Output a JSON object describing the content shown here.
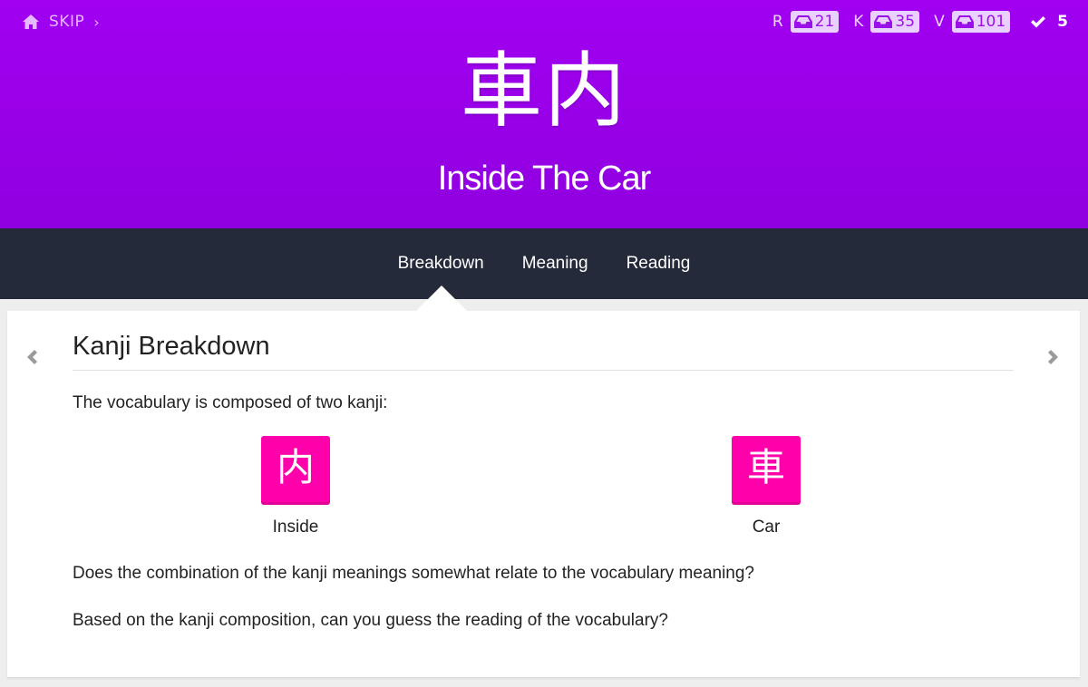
{
  "header": {
    "skip_label": "SKIP",
    "skip_chevron": "›",
    "character": "車内",
    "meaning": "Inside The Car",
    "stats": [
      {
        "letter": "R",
        "count": "21"
      },
      {
        "letter": "K",
        "count": "35"
      },
      {
        "letter": "V",
        "count": "101"
      }
    ],
    "done_count": "5"
  },
  "nav": {
    "tabs": [
      "Breakdown",
      "Meaning",
      "Reading"
    ],
    "active_tab": "Breakdown"
  },
  "content": {
    "title": "Kanji Breakdown",
    "intro": "The vocabulary is composed of two kanji:",
    "kanji": [
      {
        "character": "内",
        "meaning": "Inside"
      },
      {
        "character": "車",
        "meaning": "Car"
      }
    ],
    "question1": "Does the combination of the kanji meanings somewhat relate to the vocabulary meaning?",
    "question2": "Based on the kanji composition, can you guess the reading of the vocabulary?"
  },
  "colors": {
    "header_purple": "#a100f1",
    "nav_dark": "#252a3a",
    "kanji_pink": "#ff00aa"
  },
  "icons": [
    "home-icon",
    "inbox-icon",
    "check-icon",
    "chevron-left-icon",
    "chevron-right-icon"
  ]
}
